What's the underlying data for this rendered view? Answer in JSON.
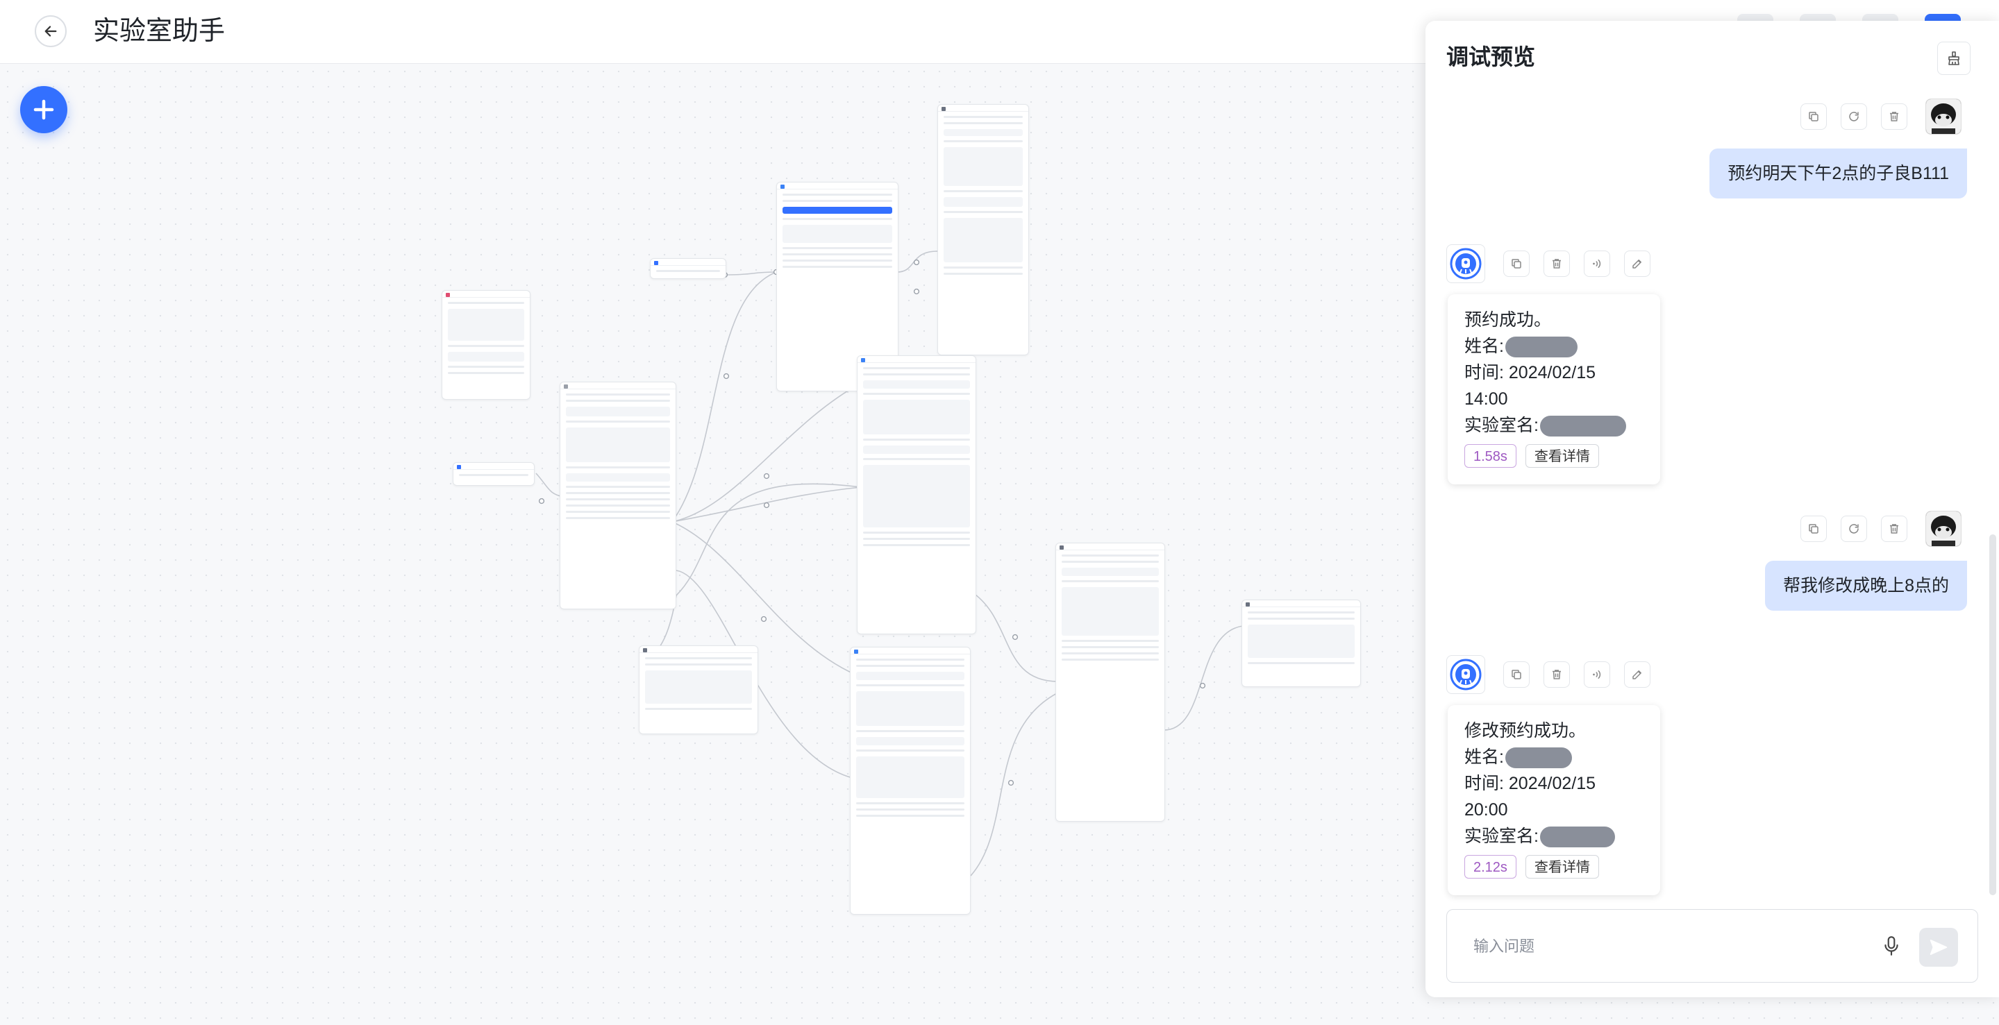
{
  "header": {
    "title": "实验室助手",
    "back_icon": "arrow-left-icon"
  },
  "canvas": {
    "add_icon": "plus-icon",
    "accent": "#3370ff"
  },
  "panel": {
    "title": "调试预览",
    "clear_icon": "broom-clear-icon"
  },
  "messages": [
    {
      "role": "user",
      "text": "预约明天下午2点的子良B111"
    },
    {
      "role": "ai",
      "lines": [
        "预约成功。",
        "姓名:",
        "时间: 2024/02/15 14:00",
        "实验室名:"
      ],
      "time": "1.58s",
      "detail": "查看详情"
    },
    {
      "role": "user",
      "text": "帮我修改成晚上8点的"
    },
    {
      "role": "ai",
      "lines": [
        "修改预约成功。",
        "姓名:",
        "时间: 2024/02/15 20:00",
        "实验室名:"
      ],
      "time": "2.12s",
      "detail": "查看详情"
    }
  ],
  "input": {
    "placeholder": "输入问题",
    "value": ""
  },
  "colors": {
    "user_bubble": "#d7e4ff",
    "time_chip": "#9e59c2",
    "brand": "#3370ff"
  }
}
